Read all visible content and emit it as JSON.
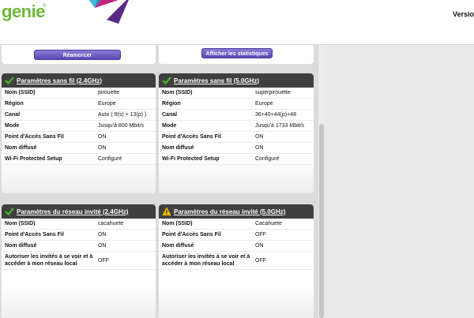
{
  "header": {
    "logo_text": "genie",
    "logo_reg": "®",
    "version_label": "Versio"
  },
  "buttons": {
    "rearm": "Réamorcer",
    "stats": "Afficher les statistiques"
  },
  "cards": {
    "wifi24": {
      "title": "Paramètres sans fil (2.4GHz)",
      "icon": "check-icon",
      "rows": [
        {
          "label": "Nom (SSID)",
          "value": "pirouette"
        },
        {
          "label": "Région",
          "value": "Europe"
        },
        {
          "label": "Canal",
          "value": "Auto ( 9(s) + 13(p) )"
        },
        {
          "label": "Mode",
          "value": "Jusqu'à 800 Mbit/s"
        },
        {
          "label": "Point d'Accès Sans Fil",
          "value": "ON"
        },
        {
          "label": "Nom diffusé",
          "value": "ON"
        },
        {
          "label": "Wi-Fi Protected Setup",
          "value": "Configuré"
        }
      ]
    },
    "wifi50": {
      "title": "Paramètres sans fil (5.0GHz)",
      "icon": "check-icon",
      "rows": [
        {
          "label": "Nom (SSID)",
          "value": "superpirouette"
        },
        {
          "label": "Région",
          "value": "Europe"
        },
        {
          "label": "Canal",
          "value": "36+40+44(p)+48"
        },
        {
          "label": "Mode",
          "value": "Jusqu'à 1733 Mbit/s"
        },
        {
          "label": "Point d'Accès Sans Fil",
          "value": "ON"
        },
        {
          "label": "Nom diffusé",
          "value": "ON"
        },
        {
          "label": "Wi-Fi Protected Setup",
          "value": "Configuré"
        }
      ]
    },
    "guest24": {
      "title": "Paramètres du réseau invité (2.4GHz)",
      "icon": "check-icon",
      "rows": [
        {
          "label": "Nom (SSID)",
          "value": "cacahuete"
        },
        {
          "label": "Point d'Accès Sans Fil",
          "value": "ON"
        },
        {
          "label": "Nom diffusé",
          "value": "ON"
        },
        {
          "label": "Autoriser les invités à se voir et à accéder à mon réseau local",
          "value": "OFF"
        }
      ]
    },
    "guest50": {
      "title": "Paramètres du réseau invité (5.0GHz)",
      "icon": "warning-icon",
      "rows": [
        {
          "label": "Nom (SSID)",
          "value": "Cacahuete"
        },
        {
          "label": "Point d'Accès Sans Fil",
          "value": "OFF"
        },
        {
          "label": "Nom diffusé",
          "value": "ON"
        },
        {
          "label": "Autoriser les invités à se voir et à accéder à mon réseau local",
          "value": "OFF"
        }
      ]
    }
  },
  "colors": {
    "brand_green": "#6fb93a",
    "header_dark": "#3f3f3f",
    "button_purple": "#6b58c2",
    "check_green": "#4caf28",
    "warning_yellow": "#f2c200"
  }
}
